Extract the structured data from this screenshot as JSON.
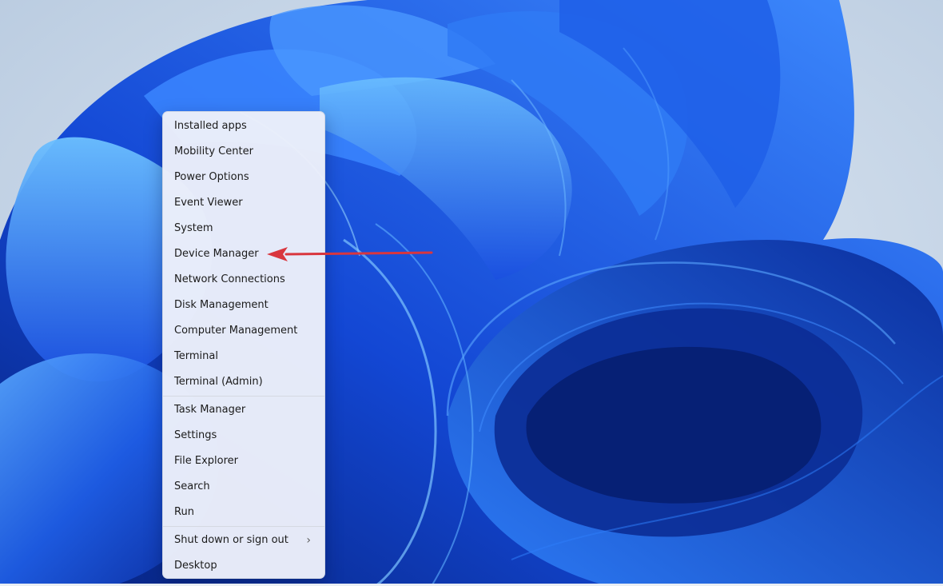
{
  "winx_menu": {
    "items": [
      {
        "label": "Installed apps",
        "name": "menu-item-installed-apps"
      },
      {
        "label": "Mobility Center",
        "name": "menu-item-mobility-center"
      },
      {
        "label": "Power Options",
        "name": "menu-item-power-options"
      },
      {
        "label": "Event Viewer",
        "name": "menu-item-event-viewer"
      },
      {
        "label": "System",
        "name": "menu-item-system"
      },
      {
        "label": "Device Manager",
        "name": "menu-item-device-manager"
      },
      {
        "label": "Network Connections",
        "name": "menu-item-network-connections"
      },
      {
        "label": "Disk Management",
        "name": "menu-item-disk-management"
      },
      {
        "label": "Computer Management",
        "name": "menu-item-computer-management"
      },
      {
        "label": "Terminal",
        "name": "menu-item-terminal"
      },
      {
        "label": "Terminal (Admin)",
        "name": "menu-item-terminal-admin"
      },
      {
        "label": "Task Manager",
        "name": "menu-item-task-manager"
      },
      {
        "label": "Settings",
        "name": "menu-item-settings"
      },
      {
        "label": "File Explorer",
        "name": "menu-item-file-explorer"
      },
      {
        "label": "Search",
        "name": "menu-item-search"
      },
      {
        "label": "Run",
        "name": "menu-item-run"
      },
      {
        "label": "Shut down or sign out",
        "name": "menu-item-shut-down-or-sign-out",
        "submenu": true
      },
      {
        "label": "Desktop",
        "name": "menu-item-desktop"
      }
    ],
    "chevron_glyph": "›"
  },
  "annotation": {
    "arrow_icon": "red-arrow-icon",
    "arrow_color": "#d9363e",
    "points_to": "Device Manager"
  },
  "colors": {
    "wallpaper_blue": "#1e5bf0",
    "wallpaper_background": "#c7d6e6",
    "menu_background": "#ecf0fa"
  }
}
